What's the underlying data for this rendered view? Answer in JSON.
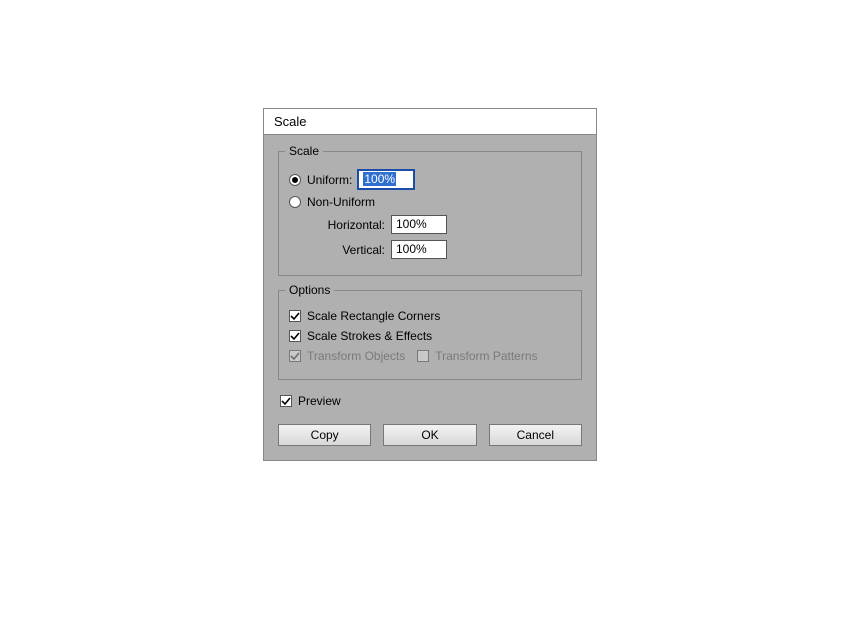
{
  "dialog": {
    "title": "Scale",
    "scale": {
      "legend": "Scale",
      "uniform_label": "Uniform:",
      "uniform_value": "100%",
      "nonuniform_label": "Non-Uniform",
      "horizontal_label": "Horizontal:",
      "horizontal_value": "100%",
      "vertical_label": "Vertical:",
      "vertical_value": "100%"
    },
    "options": {
      "legend": "Options",
      "scale_corners_label": "Scale Rectangle Corners",
      "scale_strokes_label": "Scale Strokes & Effects",
      "transform_objects_label": "Transform Objects",
      "transform_patterns_label": "Transform Patterns"
    },
    "preview_label": "Preview",
    "buttons": {
      "copy": "Copy",
      "ok": "OK",
      "cancel": "Cancel"
    }
  }
}
